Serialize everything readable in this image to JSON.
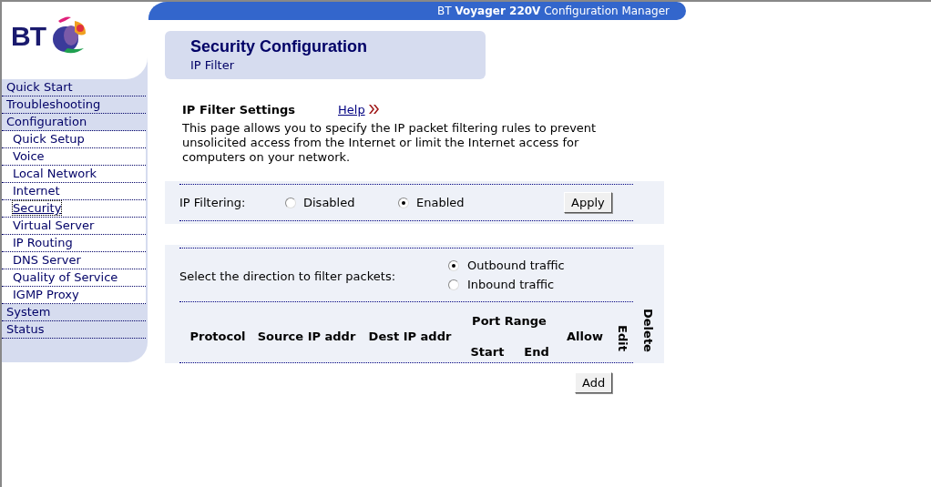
{
  "header": {
    "title": "BT **Voyager 220V** Configuration Manager"
  },
  "logo": {
    "text": "BT"
  },
  "sidebar": {
    "items": [
      {
        "label": "Quick Start",
        "selected": false
      },
      {
        "label": "Troubleshooting",
        "selected": false
      },
      {
        "label": "Configuration",
        "selected": false,
        "children": [
          {
            "label": "Quick Setup",
            "selected": false
          },
          {
            "label": "Voice",
            "selected": false
          },
          {
            "label": "Local Network",
            "selected": false
          },
          {
            "label": "Internet",
            "selected": false
          },
          {
            "label": "Security",
            "selected": true
          },
          {
            "label": "Virtual Server",
            "selected": false
          },
          {
            "label": "IP Routing",
            "selected": false
          },
          {
            "label": "DNS Server",
            "selected": false
          },
          {
            "label": "Quality of Service",
            "selected": false
          },
          {
            "label": "IGMP Proxy",
            "selected": false
          }
        ]
      },
      {
        "label": "System",
        "selected": false
      },
      {
        "label": "Status",
        "selected": false
      }
    ]
  },
  "page": {
    "title": "Security Configuration",
    "subtitle": "IP Filter",
    "section_title": "IP Filter Settings",
    "help_link": "Help",
    "description": "This page allows you to specify the IP packet filtering rules to prevent unsolicited access from the Internet or limit the Internet access for computers on your network."
  },
  "ip_filtering": {
    "label": "IP Filtering:",
    "options": [
      {
        "label": "Disabled",
        "selected": false
      },
      {
        "label": "Enabled",
        "selected": true
      }
    ],
    "apply_button": "Apply"
  },
  "direction": {
    "label": "Select the direction to filter packets:",
    "options": [
      {
        "label": "Outbound traffic",
        "selected": true
      },
      {
        "label": "Inbound traffic",
        "selected": false
      }
    ]
  },
  "table": {
    "columns": [
      {
        "label": "Protocol",
        "kind": "plain"
      },
      {
        "label": "Source IP addr",
        "kind": "plain"
      },
      {
        "label": "Dest IP addr",
        "kind": "plain"
      },
      {
        "label": "Port Range",
        "kind": "group",
        "children": [
          {
            "label": "Start"
          },
          {
            "label": "End"
          }
        ]
      },
      {
        "label": "Allow",
        "kind": "plain"
      },
      {
        "label": "Edit",
        "kind": "vertical"
      },
      {
        "label": "Delete",
        "kind": "vertical"
      }
    ]
  },
  "add_button": "Add"
}
